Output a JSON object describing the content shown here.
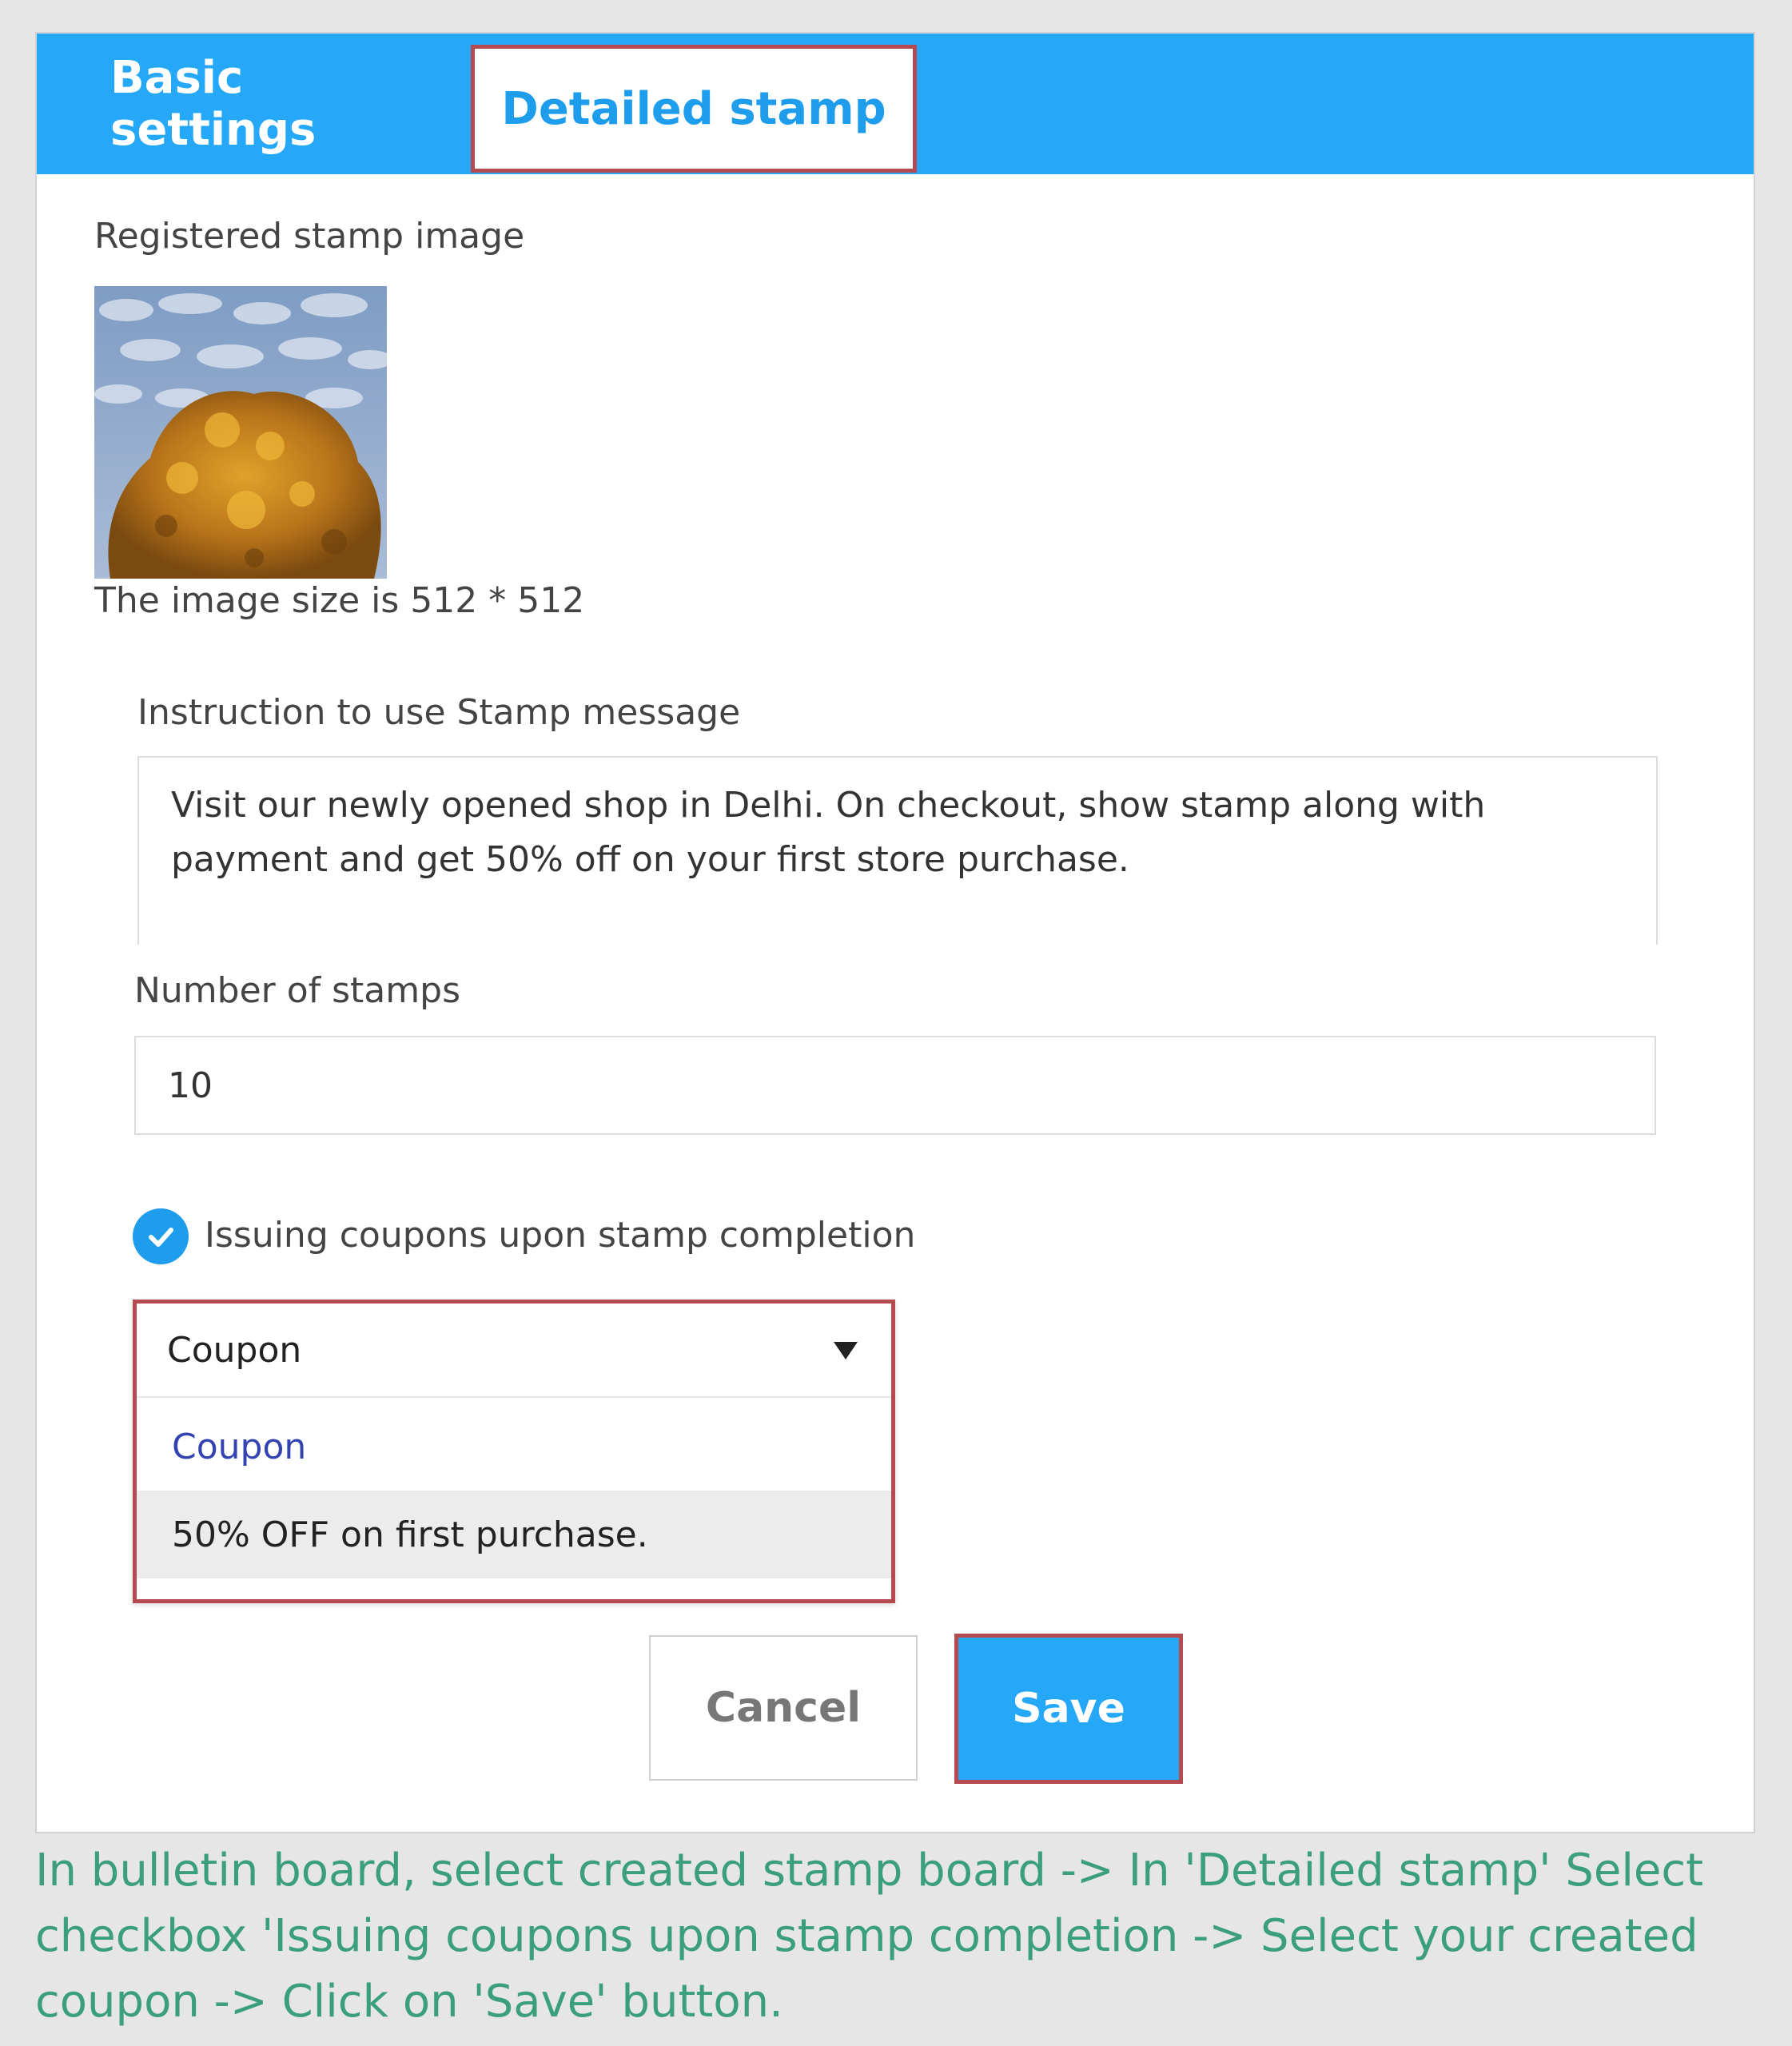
{
  "tabs": {
    "basic": "Basic settings",
    "detailed": "Detailed stamp"
  },
  "stamp": {
    "label": "Registered stamp image",
    "size_note": "The image size is 512 * 512"
  },
  "instruction": {
    "label": "Instruction to use Stamp message",
    "value": "Visit our newly opened shop in Delhi. On checkout, show stamp along with payment and get 50% off on your first store purchase."
  },
  "stamps": {
    "label": "Number of stamps",
    "value": "10"
  },
  "coupon_checkbox": {
    "label": "Issuing coupons upon stamp completion",
    "checked": true
  },
  "coupon_select": {
    "selected": "Coupon",
    "options": [
      "Coupon",
      "50% OFF on first purchase."
    ]
  },
  "buttons": {
    "cancel": "Cancel",
    "save": "Save"
  },
  "caption": "In bulletin board, select created stamp board -> In 'Detailed stamp' Select checkbox 'Issuing coupons upon stamp completion -> Select your created coupon -> Click on 'Save' button.",
  "colors": {
    "accent": "#25a8f7",
    "highlight_border": "#b64a50",
    "caption": "#3a9f7a"
  }
}
